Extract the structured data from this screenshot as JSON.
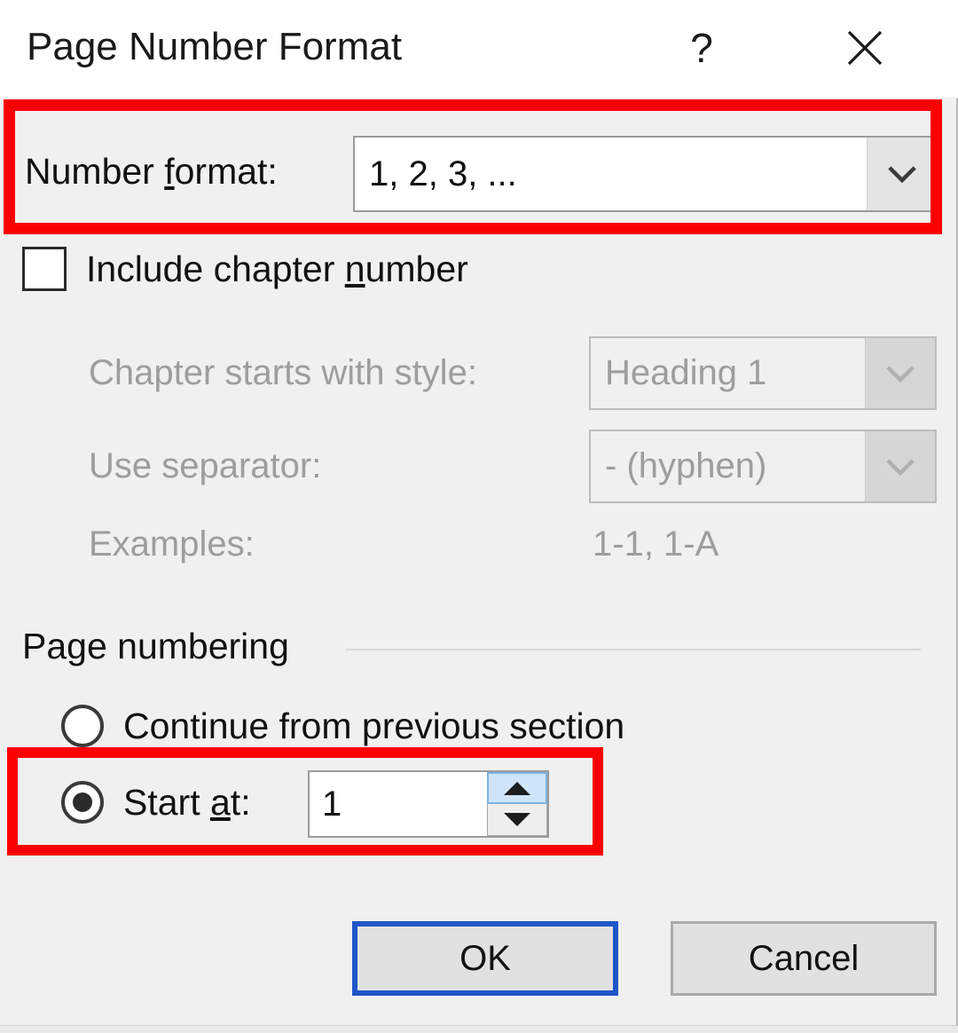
{
  "dialog": {
    "title": "Page Number Format",
    "help_icon": "question-mark-icon",
    "help_label": "?",
    "close_icon": "close-icon",
    "accent_focus_color": "#1f56c8",
    "annotation_color": "#fb0000"
  },
  "number_format": {
    "label_prefix": "Number ",
    "label_accel": "f",
    "label_suffix": "ormat:",
    "value": "1, 2, 3, ...",
    "dropdown_icon": "chevron-down-icon"
  },
  "include_chapter": {
    "checked": false,
    "label_prefix": "Include chapter ",
    "label_accel": "n",
    "label_suffix": "umber"
  },
  "chapter_style": {
    "label": "Chapter starts with style:",
    "value": "Heading 1",
    "disabled": true,
    "dropdown_icon": "chevron-down-icon"
  },
  "separator": {
    "label": "Use separator:",
    "value": "-   (hyphen)",
    "disabled": true,
    "dropdown_icon": "chevron-down-icon"
  },
  "examples": {
    "label": "Examples:",
    "value": "1-1, 1-A",
    "disabled": true
  },
  "page_numbering": {
    "group_label": "Page numbering",
    "continue": {
      "label": "Continue from previous section",
      "selected": false
    },
    "start_at": {
      "label_prefix": "Start ",
      "label_accel": "a",
      "label_suffix": "t:",
      "selected": true,
      "value": "1",
      "spinner_up_icon": "triangle-up-icon",
      "spinner_down_icon": "triangle-down-icon"
    }
  },
  "footer": {
    "ok_label": "OK",
    "cancel_label": "Cancel"
  }
}
